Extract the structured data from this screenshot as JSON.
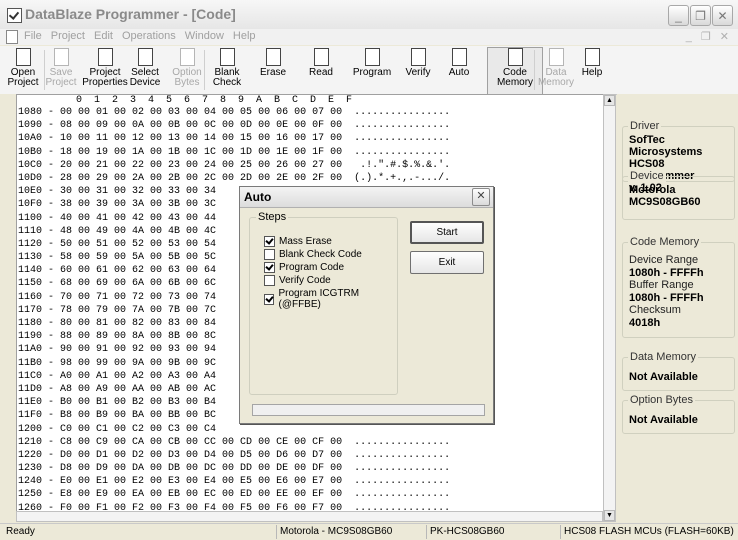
{
  "window": {
    "title": "DataBlaze Programmer - [Code]"
  },
  "menu": [
    "File",
    "Project",
    "Edit",
    "Operations",
    "Window",
    "Help"
  ],
  "toolbar": [
    {
      "label": "Open\nProject",
      "enabled": true,
      "icon": "folder-open-icon"
    },
    {
      "label": "Save\nProject",
      "enabled": false,
      "icon": "save-icon"
    },
    {
      "label": "Project\nProperties",
      "enabled": true,
      "icon": "properties-icon"
    },
    {
      "label": "Select\nDevice",
      "enabled": true,
      "icon": "device-icon"
    },
    {
      "label": "Option\nBytes",
      "enabled": false,
      "icon": "option-bytes-icon"
    },
    {
      "label": "Blank\nCheck",
      "enabled": true,
      "icon": "blank-check-icon"
    },
    {
      "label": "Erase",
      "enabled": true,
      "icon": "erase-icon"
    },
    {
      "label": "Read",
      "enabled": true,
      "icon": "read-icon"
    },
    {
      "label": "Program",
      "enabled": true,
      "icon": "program-icon"
    },
    {
      "label": "Verify",
      "enabled": true,
      "icon": "verify-icon"
    },
    {
      "label": "Auto",
      "enabled": true,
      "icon": "auto-icon"
    },
    {
      "label": "Code\nMemory",
      "enabled": true,
      "icon": "code-memory-icon",
      "pressed": true
    },
    {
      "label": "Data\nMemory",
      "enabled": false,
      "icon": "data-memory-icon"
    },
    {
      "label": "Help",
      "enabled": true,
      "icon": "help-icon"
    }
  ],
  "hex": {
    "header": "  0  1  2  3  4  5  6  7  8  9  A  B  C  D  E  F",
    "rows": [
      [
        "1080",
        "00 00 01 00 02 00 03 00 04 00 05 00 06 00 07 00",
        "................"
      ],
      [
        "1090",
        "08 00 09 00 0A 00 0B 00 0C 00 0D 00 0E 00 0F 00",
        "................"
      ],
      [
        "10A0",
        "10 00 11 00 12 00 13 00 14 00 15 00 16 00 17 00",
        "................"
      ],
      [
        "10B0",
        "18 00 19 00 1A 00 1B 00 1C 00 1D 00 1E 00 1F 00",
        "................"
      ],
      [
        "10C0",
        "20 00 21 00 22 00 23 00 24 00 25 00 26 00 27 00",
        " .!.\".#.$.%.&.'."
      ],
      [
        "10D0",
        "28 00 29 00 2A 00 2B 00 2C 00 2D 00 2E 00 2F 00",
        "(.).*.+.,.-.../."
      ],
      [
        "10E0",
        "30 00 31 00 32 00 33 00 34",
        ""
      ],
      [
        "10F0",
        "38 00 39 00 3A 00 3B 00 3C",
        ""
      ],
      [
        "1100",
        "40 00 41 00 42 00 43 00 44",
        ""
      ],
      [
        "1110",
        "48 00 49 00 4A 00 4B 00 4C",
        ""
      ],
      [
        "1120",
        "50 00 51 00 52 00 53 00 54",
        ""
      ],
      [
        "1130",
        "58 00 59 00 5A 00 5B 00 5C",
        ""
      ],
      [
        "1140",
        "60 00 61 00 62 00 63 00 64",
        ""
      ],
      [
        "1150",
        "68 00 69 00 6A 00 6B 00 6C",
        ""
      ],
      [
        "1160",
        "70 00 71 00 72 00 73 00 74",
        ""
      ],
      [
        "1170",
        "78 00 79 00 7A 00 7B 00 7C",
        ""
      ],
      [
        "1180",
        "80 00 81 00 82 00 83 00 84",
        ""
      ],
      [
        "1190",
        "88 00 89 00 8A 00 8B 00 8C",
        ""
      ],
      [
        "11A0",
        "90 00 91 00 92 00 93 00 94",
        ""
      ],
      [
        "11B0",
        "98 00 99 00 9A 00 9B 00 9C",
        ""
      ],
      [
        "11C0",
        "A0 00 A1 00 A2 00 A3 00 A4",
        ""
      ],
      [
        "11D0",
        "A8 00 A9 00 AA 00 AB 00 AC",
        ""
      ],
      [
        "11E0",
        "B0 00 B1 00 B2 00 B3 00 B4",
        ""
      ],
      [
        "11F0",
        "B8 00 B9 00 BA 00 BB 00 BC",
        ""
      ],
      [
        "1200",
        "C0 00 C1 00 C2 00 C3 00 C4",
        ""
      ],
      [
        "1210",
        "C8 00 C9 00 CA 00 CB 00 CC 00 CD 00 CE 00 CF 00",
        "................"
      ],
      [
        "1220",
        "D0 00 D1 00 D2 00 D3 00 D4 00 D5 00 D6 00 D7 00",
        "................"
      ],
      [
        "1230",
        "D8 00 D9 00 DA 00 DB 00 DC 00 DD 00 DE 00 DF 00",
        "................"
      ],
      [
        "1240",
        "E0 00 E1 00 E2 00 E3 00 E4 00 E5 00 E6 00 E7 00",
        "................"
      ],
      [
        "1250",
        "E8 00 E9 00 EA 00 EB 00 EC 00 ED 00 EE 00 EF 00",
        "................"
      ],
      [
        "1260",
        "F0 00 F1 00 F2 00 F3 00 F4 00 F5 00 F6 00 F7 00",
        "................"
      ],
      [
        "1270",
        "F8 00 F9 00 FA 00 FB 00 FC 00 FD 00 FE 00 FF 00",
        "................"
      ]
    ]
  },
  "side": {
    "driver": {
      "title": "Driver",
      "name": "SofTec Microsystems",
      "prog": "HCS08 Programmer",
      "ver": "v. 1.02"
    },
    "device": {
      "title": "Device",
      "vendor": "Motorola",
      "part": "MC9S08GB60"
    },
    "code_memory": {
      "title": "Code Memory",
      "device_range_label": "Device Range",
      "device_range": "1080h - FFFFh",
      "buffer_range_label": "Buffer Range",
      "buffer_range": "1080h - FFFFh",
      "checksum_label": "Checksum",
      "checksum": "4018h"
    },
    "data_memory": {
      "title": "Data Memory",
      "value": "Not Available"
    },
    "option_bytes": {
      "title": "Option Bytes",
      "value": "Not Available"
    }
  },
  "status": {
    "ready": "Ready",
    "device": "Motorola - MC9S08GB60",
    "programmer": "PK-HCS08GB60",
    "family": "HCS08 FLASH MCUs (FLASH=60KB)"
  },
  "dialog": {
    "title": "Auto",
    "group": "Steps",
    "steps": [
      {
        "label": "Mass Erase",
        "checked": true
      },
      {
        "label": "Blank Check Code",
        "checked": false
      },
      {
        "label": "Program Code",
        "checked": true
      },
      {
        "label": "Verify Code",
        "checked": false
      },
      {
        "label": "Program ICGTRM (@FFBE)",
        "checked": true
      }
    ],
    "start": "Start",
    "exit": "Exit"
  }
}
